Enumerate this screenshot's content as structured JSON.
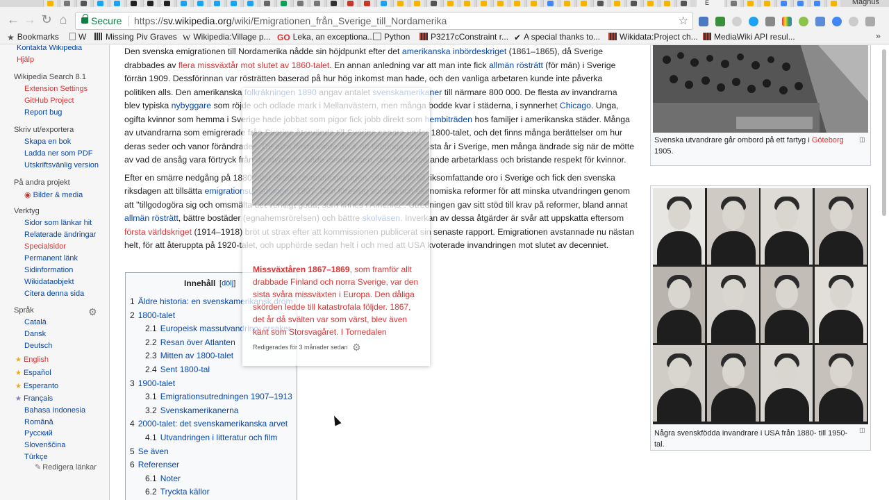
{
  "browser": {
    "active_tab_label": "E",
    "profile_name": "Magnus",
    "secure_label": "Secure",
    "url_prefix": "https://",
    "url_domain": "sv.wikipedia.org",
    "url_path": "/wiki/Emigrationen_från_Sverige_till_Nordamerika"
  },
  "bookmarks": [
    {
      "label": "Bookmarks"
    },
    {
      "label": "W"
    },
    {
      "label": "Missing Piv Graves"
    },
    {
      "label": "Wikipedia:Village p..."
    },
    {
      "label": "Leka, an exceptiona..."
    },
    {
      "label": "Python"
    },
    {
      "label": "P3217cConstraint r..."
    },
    {
      "label": "A special thanks to..."
    },
    {
      "label": "Wikidata:Project ch..."
    },
    {
      "label": "MediaWiki API resul..."
    }
  ],
  "sidebar": {
    "top_links": [
      "Kontakta Wikipedia",
      "Hjälp"
    ],
    "search_head": "Wikipedia Search 8.1",
    "search_links": [
      "Extension Settings",
      "GitHub Project",
      "Report bug"
    ],
    "print_head": "Skriv ut/exportera",
    "print_links": [
      "Skapa en bok",
      "Ladda ner som PDF",
      "Utskriftsvänlig version"
    ],
    "projects_head": "På andra projekt",
    "projects_links": [
      "Bilder & media"
    ],
    "tools_head": "Verktyg",
    "tools_links": [
      "Sidor som länkar hit",
      "Relaterade ändringar",
      "Specialsidor",
      "Permanent länk",
      "Sidinformation",
      "Wikidataobjekt",
      "Citera denna sida"
    ],
    "lang_head": "Språk",
    "languages": [
      "Català",
      "Dansk",
      "Deutsch",
      "English",
      "Español",
      "Esperanto",
      "Français",
      "Bahasa Indonesia",
      "Română",
      "Русский",
      "Slovenščina",
      "Türkçe"
    ],
    "edit_links": "Redigera länkar"
  },
  "article": {
    "p1": [
      {
        "t": "Den svenska emigrationen till Nordamerika nådde sin höjdpunkt efter det "
      },
      {
        "t": "amerikanska inbördeskriget",
        "link": "blue"
      },
      {
        "t": " (1861–1865), då Sverige drabbades av "
      },
      {
        "t": "flera missväxtår mot slutet av 1860-talet",
        "link": "red"
      },
      {
        "t": ". En annan anledning var att man inte fick "
      },
      {
        "t": "allmän rösträtt",
        "link": "blue"
      },
      {
        "t": " (för män) i Sverige förrän 1909. Dessförinnan var rösträtten baserad på hur hög inkomst man hade, och den vanliga arbetaren kunde inte påverka politiken alls. Den amerikanska "
      },
      {
        "t": "folkräkningen 1890",
        "link": "blue"
      },
      {
        "t": " angav antalet "
      },
      {
        "t": "svenskamerikaner",
        "link": "blue"
      },
      {
        "t": " till närmare 800 000. De flesta av invandrarna blev typiska "
      },
      {
        "t": "nybyggare",
        "link": "blue"
      },
      {
        "t": " som röjde och odlade mark i Mellanvästern, men många bodde kvar i städerna, i synnerhet "
      },
      {
        "t": "Chicago",
        "link": "blue"
      },
      {
        "t": ". Unga, ogifta kvinnor som hemma i Sverige hade jobbat som pigor fick jobb direkt som "
      },
      {
        "t": "hembiträden",
        "link": "blue"
      },
      {
        "t": " hos familjer i amerikanska städer. Många av utvandrarna som emigrerade från Sverige återvände till Sverige senare under 1800-talet, och det finns många berättelser om hur deras seder och vanor förändrades. De allra flesta valde dock att tillbringa sina sista år i Sverige, men många ändrade sig när de mötte av vad de ansåg vara förtryck från de styrande, både överklassen, den hårt arbetande arbetarklass och bristande respekt för kvinnor."
      }
    ],
    "p2": [
      {
        "t": "Efter en smärre nedgång på 1880-talet ökade utvandringen igen, vilket ledde till riksomfattande oro i Sverige och fick den svenska riksdagen att tillsätta "
      },
      {
        "t": "emigrationsutredningen",
        "link": "blue"
      },
      {
        "t": " 1907. Den föreslog sociala och ekonomiska reformer för att minska utvandringen genom att \"tillgodogöra sig och omsmälta det verkligt goda, som finnes i Amerika\". Utredningen gav sitt stöd till krav på reformer, bland annat "
      },
      {
        "t": "allmän rösträtt",
        "link": "blue"
      },
      {
        "t": ", bättre bostäder (egnahemsrörelsen) och bättre "
      },
      {
        "t": "skolväsen",
        "link": "blue"
      },
      {
        "t": ". Inverkan av dessa åtgärder är svår att uppskatta eftersom "
      },
      {
        "t": "första världskriget",
        "link": "red"
      },
      {
        "t": " (1914–1918) bröt ut strax efter att kommissionen publicerat sin senaste rapport. Emigrationen avstannade nu nästan helt, för att återuppta på 1920-talet, och upphörde sedan helt i och med att USA kvoterade invandringen mot slutet av decenniet."
      }
    ]
  },
  "toc": {
    "title": "Innehåll",
    "toggle": "dölj",
    "items": [
      {
        "num": "1",
        "label": "Äldre historia: en svenskamerikansk dröm"
      },
      {
        "num": "2",
        "label": "1800-talet"
      },
      {
        "num": "2.1",
        "label": "Europeisk massutvandring: orsaker"
      },
      {
        "num": "2.2",
        "label": "Resan över Atlanten"
      },
      {
        "num": "2.3",
        "label": "Mitten av 1800-talet"
      },
      {
        "num": "2.4",
        "label": "Sent 1800-tal"
      },
      {
        "num": "3",
        "label": "1900-talet"
      },
      {
        "num": "3.1",
        "label": "Emigrationsutredningen 1907–1913"
      },
      {
        "num": "3.2",
        "label": "Svenskamerikanerna"
      },
      {
        "num": "4",
        "label": "2000-talet: det svenskamerikanska arvet"
      },
      {
        "num": "4.1",
        "label": "Utvandringen i litteratur och film"
      },
      {
        "num": "5",
        "label": "Se även"
      },
      {
        "num": "6",
        "label": "Referenser"
      },
      {
        "num": "6.1",
        "label": "Noter"
      },
      {
        "num": "6.2",
        "label": "Tryckta källor"
      }
    ]
  },
  "images": {
    "caption1_text": "Svenska utvandrare går ombord på ett fartyg i ",
    "caption1_link": "Göteborg",
    "caption1_tail": " 1905.",
    "caption2": "Några svenskfödda invandrare i USA från 1880- till 1950-tal."
  },
  "popup": {
    "title": "Missväxtåren 1867–1869",
    "text": ", som framför allt drabbade Finland och norra Sverige, var den sista svåra missväxten i Europa. Den dåliga skörden ledde till katastrofala följder. 1867, det år då svälten var som värst, blev även känt som Storsvagåret. I Tornedalen",
    "footer": "Redigerades för 3 månader sedan"
  },
  "colors": {
    "link_blue": "#0645ad",
    "link_red": "#dd3333",
    "secure_green": "#0b8043"
  }
}
